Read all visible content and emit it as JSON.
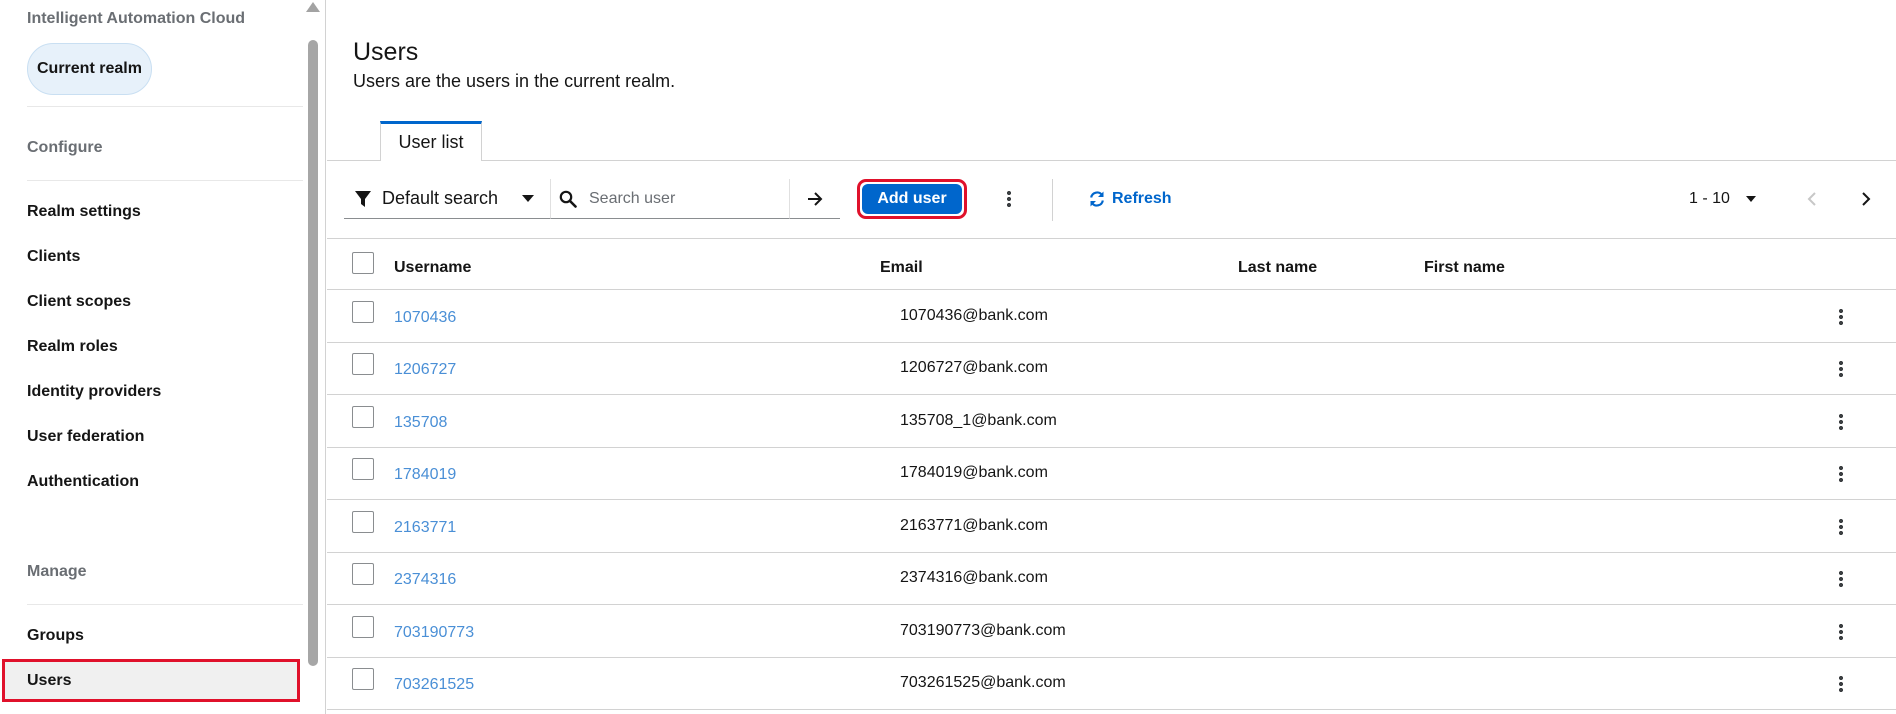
{
  "sidebar": {
    "app_name": "Intelligent Automation Cloud",
    "realm_label": "Current realm",
    "sections": {
      "configure": "Configure",
      "manage": "Manage"
    },
    "configure_items": [
      {
        "label": "Realm settings"
      },
      {
        "label": "Clients"
      },
      {
        "label": "Client scopes"
      },
      {
        "label": "Realm roles"
      },
      {
        "label": "Identity providers"
      },
      {
        "label": "User federation"
      },
      {
        "label": "Authentication"
      }
    ],
    "manage_items": [
      {
        "label": "Groups"
      },
      {
        "label": "Users"
      }
    ]
  },
  "header": {
    "title": "Users",
    "description": "Users are the users in the current realm."
  },
  "tabs": [
    {
      "label": "User list"
    }
  ],
  "toolbar": {
    "filter_label": "Default search",
    "search_placeholder": "Search user",
    "search_value": "",
    "add_user_label": "Add user",
    "refresh_label": "Refresh",
    "pagination_label": "1 - 10"
  },
  "table": {
    "columns": [
      "Username",
      "Email",
      "Last name",
      "First name"
    ],
    "rows": [
      {
        "username": "1070436",
        "email": "1070436@bank.com",
        "last_name": "",
        "first_name": ""
      },
      {
        "username": "1206727",
        "email": "1206727@bank.com",
        "last_name": "",
        "first_name": ""
      },
      {
        "username": "135708",
        "email": "135708_1@bank.com",
        "last_name": "",
        "first_name": ""
      },
      {
        "username": "1784019",
        "email": "1784019@bank.com",
        "last_name": "",
        "first_name": ""
      },
      {
        "username": "2163771",
        "email": "2163771@bank.com",
        "last_name": "",
        "first_name": ""
      },
      {
        "username": "2374316",
        "email": "2374316@bank.com",
        "last_name": "",
        "first_name": ""
      },
      {
        "username": "703190773",
        "email": "703190773@bank.com",
        "last_name": "",
        "first_name": ""
      },
      {
        "username": "703261525",
        "email": "703261525@bank.com",
        "last_name": "",
        "first_name": ""
      }
    ]
  },
  "colors": {
    "primary": "#0066cc",
    "link": "#4a8fd6",
    "highlight": "#e0112b",
    "realm_pill_bg": "#e7f1fa"
  }
}
